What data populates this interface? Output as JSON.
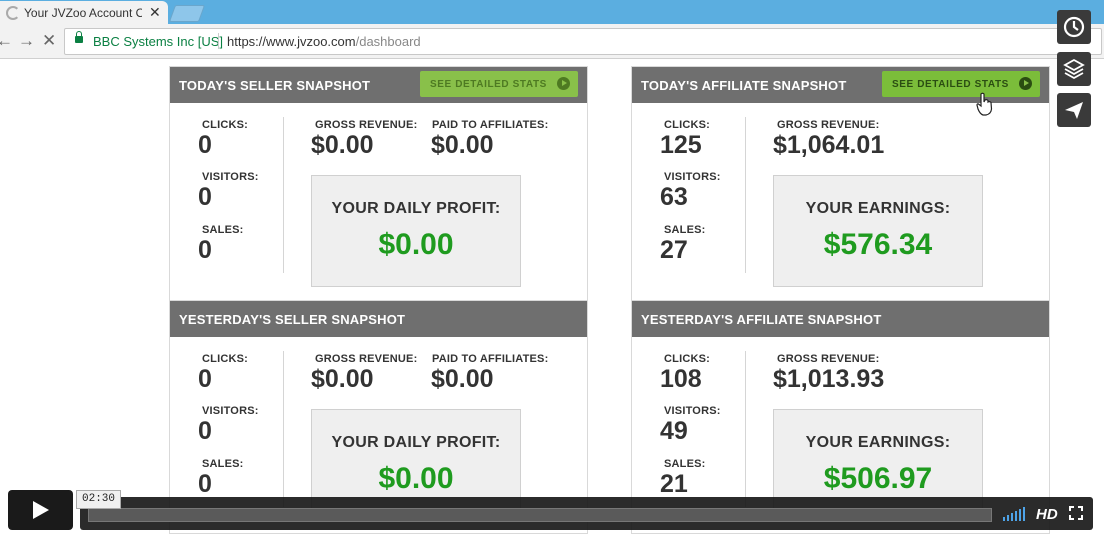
{
  "browser": {
    "tab_title": "Your JVZoo Account Ove",
    "tab_close": "✕",
    "back": "←",
    "forward": "→",
    "stop": "✕",
    "security_label": "BBC Systems Inc [US]",
    "url_host": "https://www.jvzoo.com",
    "url_path": "/dashboard"
  },
  "panels": {
    "today_seller": {
      "title": "TODAY'S SELLER SNAPSHOT",
      "button": "SEE DETAILED STATS",
      "clicks_label": "CLICKS:",
      "clicks": "0",
      "visitors_label": "VISITORS:",
      "visitors": "0",
      "sales_label": "SALES:",
      "sales": "0",
      "gross_label": "GROSS REVENUE:",
      "gross": "$0.00",
      "paid_label": "PAID TO AFFILIATES:",
      "paid": "$0.00",
      "profit_label": "YOUR DAILY PROFIT:",
      "profit": "$0.00"
    },
    "today_affiliate": {
      "title": "TODAY'S AFFILIATE SNAPSHOT",
      "button": "SEE DETAILED STATS",
      "clicks_label": "CLICKS:",
      "clicks": "125",
      "visitors_label": "VISITORS:",
      "visitors": "63",
      "sales_label": "SALES:",
      "sales": "27",
      "gross_label": "GROSS REVENUE:",
      "gross": "$1,064.01",
      "earn_label": "YOUR EARNINGS:",
      "earnings": "$576.34"
    },
    "yesterday_seller": {
      "title": "YESTERDAY'S SELLER SNAPSHOT",
      "clicks_label": "CLICKS:",
      "clicks": "0",
      "visitors_label": "VISITORS:",
      "visitors": "0",
      "sales_label": "SALES:",
      "sales": "0",
      "gross_label": "GROSS REVENUE:",
      "gross": "$0.00",
      "paid_label": "PAID TO AFFILIATES:",
      "paid": "$0.00",
      "profit_label": "YOUR DAILY PROFIT:",
      "profit": "$0.00"
    },
    "yesterday_affiliate": {
      "title": "YESTERDAY'S AFFILIATE SNAPSHOT",
      "clicks_label": "CLICKS:",
      "clicks": "108",
      "visitors_label": "VISITORS:",
      "visitors": "49",
      "sales_label": "SALES:",
      "sales": "21",
      "gross_label": "GROSS REVENUE:",
      "gross": "$1,013.93",
      "earn_label": "YOUR EARNINGS:",
      "earnings": "$506.97"
    }
  },
  "player": {
    "timecode": "02:30",
    "hd_label": "HD",
    "progress": 0.0
  },
  "colors": {
    "header": "#6f6f6f",
    "button_green": "#7bbd3a",
    "money_green": "#1f9b1f",
    "tabbar_blue": "#5baee0"
  },
  "icons": [
    "clock-icon",
    "layers-icon",
    "send-icon",
    "play-icon",
    "volume-icon",
    "fullscreen-icon",
    "lock-icon",
    "hand-cursor-icon"
  ]
}
